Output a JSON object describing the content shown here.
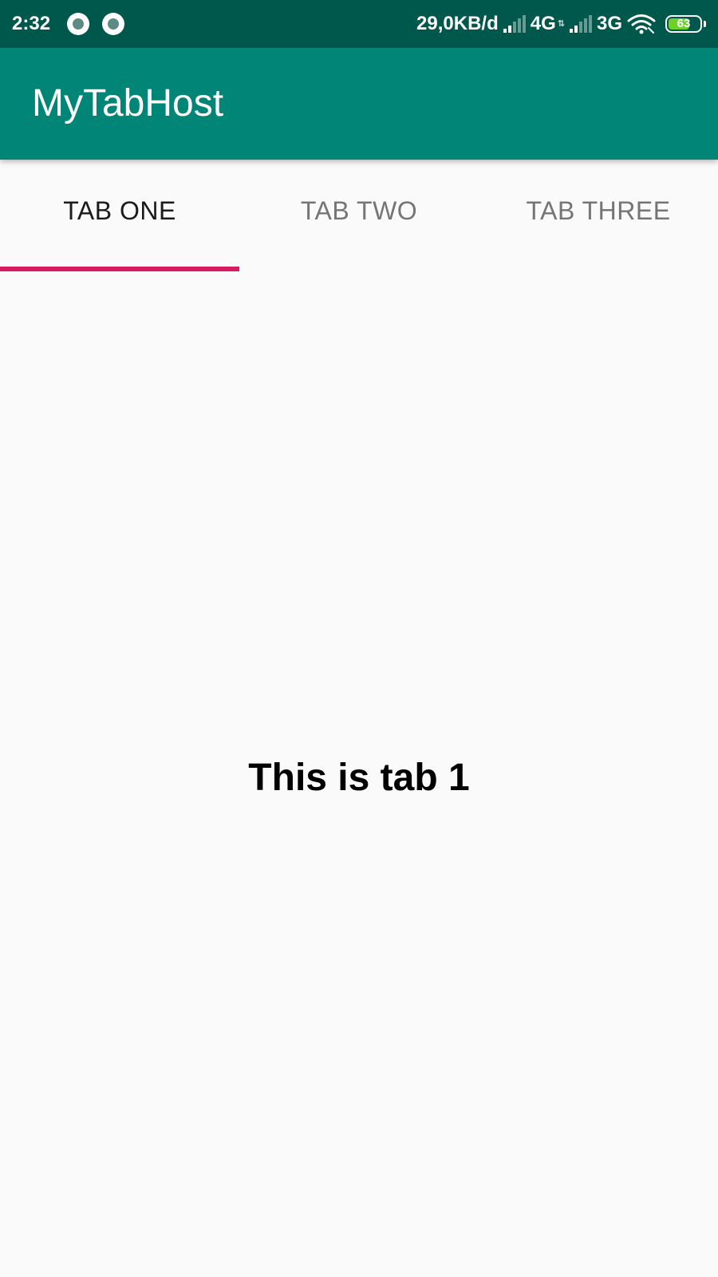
{
  "status_bar": {
    "time": "2:32",
    "network_speed": "29,0KB/d",
    "sim1_type": "4G",
    "sim2_type": "3G",
    "battery_level": "63",
    "icons": [
      "notification-icon",
      "notification-icon",
      "signal-icon",
      "signal-icon",
      "wifi-icon",
      "battery-icon"
    ]
  },
  "app_bar": {
    "title": "MyTabHost"
  },
  "tabs": [
    {
      "label": "TAB ONE",
      "selected": true
    },
    {
      "label": "TAB TWO",
      "selected": false
    },
    {
      "label": "TAB THREE",
      "selected": false
    }
  ],
  "content": {
    "text": "This is tab 1"
  },
  "colors": {
    "status_bar": "#00574b",
    "app_bar": "#008577",
    "tab_indicator": "#d81b60",
    "background": "#fafafa"
  }
}
